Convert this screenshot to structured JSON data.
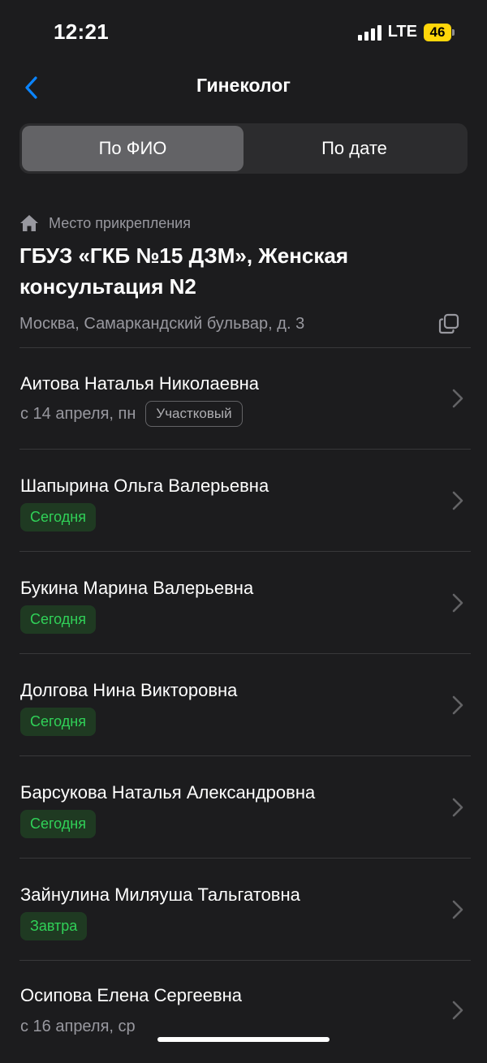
{
  "status_bar": {
    "time": "12:21",
    "network": "LTE",
    "battery": "46"
  },
  "nav": {
    "title": "Гинеколог"
  },
  "tabs": [
    {
      "label": "По ФИО",
      "active": true
    },
    {
      "label": "По дате",
      "active": false
    }
  ],
  "attachment": {
    "label": "Место прикрепления",
    "name": "ГБУЗ «ГКБ №15 ДЗМ», Женская консультация N2",
    "address": "Москва, Самаркандский бульвар, д. 3"
  },
  "doctors": [
    {
      "name": "Аитова Наталья Николаевна",
      "date": "с 14 апреля, пн",
      "tag": "Участковый"
    },
    {
      "name": "Шапырина Ольга Валерьевна",
      "badge": "Сегодня"
    },
    {
      "name": "Букина Марина Валерьевна",
      "badge": "Сегодня"
    },
    {
      "name": "Долгова Нина Викторовна",
      "badge": "Сегодня"
    },
    {
      "name": "Барсукова Наталья Александровна",
      "badge": "Сегодня"
    },
    {
      "name": "Зайнулина Миляуша Тальгатовна",
      "badge": "Завтра"
    },
    {
      "name": "Осипова Елена Сергеевна",
      "date": "с 16 апреля, ср"
    }
  ],
  "colors": {
    "background": "#1c1c1e",
    "accent": "#0a84ff",
    "success": "#30d158",
    "battery": "#ffd60a"
  }
}
